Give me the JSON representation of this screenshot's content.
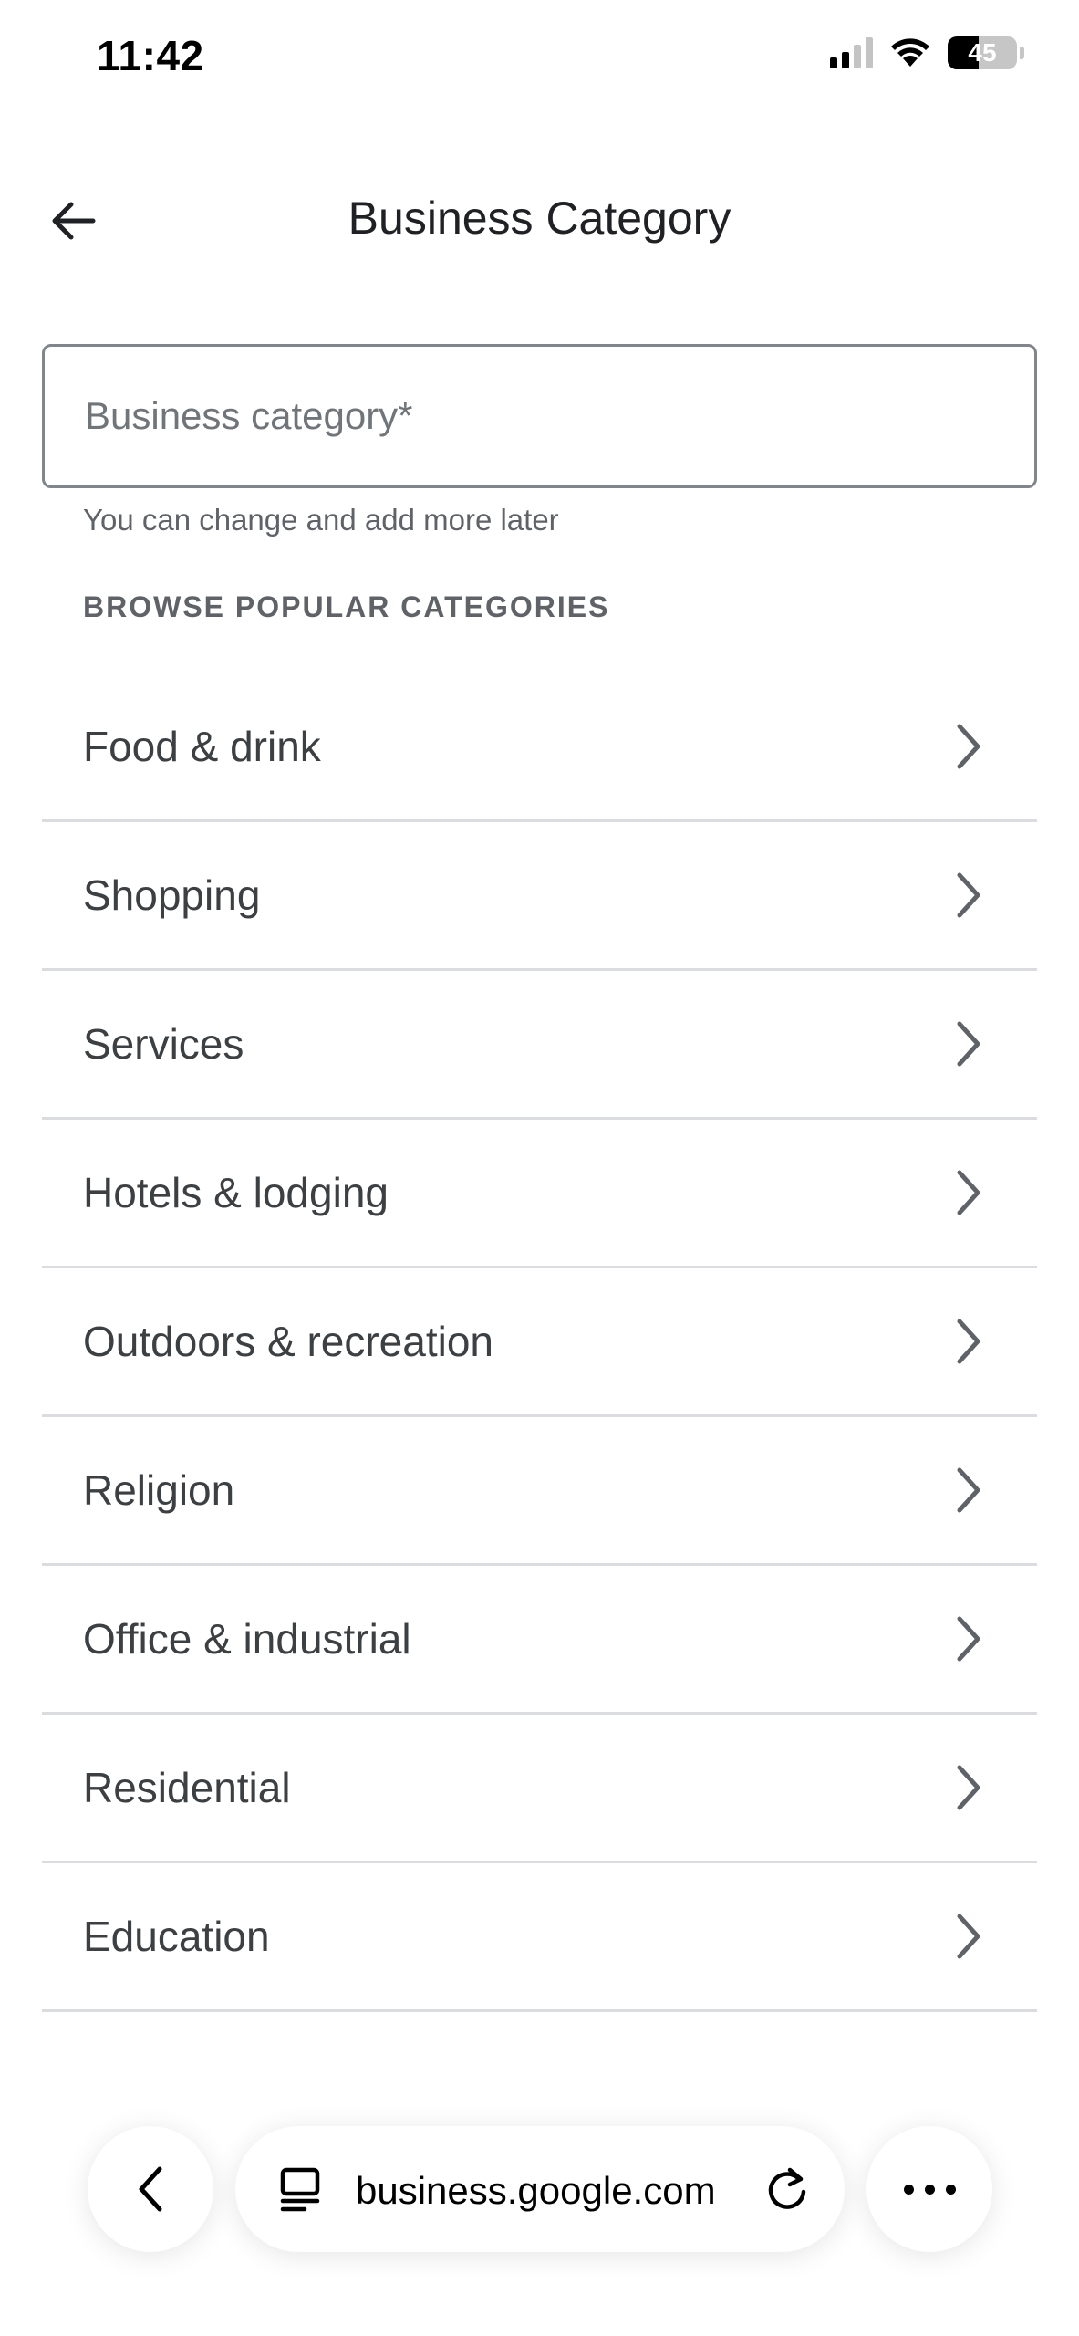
{
  "status_bar": {
    "time": "11:42",
    "battery_percent": "45"
  },
  "header": {
    "title": "Business Category",
    "back_icon": "arrow-left-icon"
  },
  "search": {
    "placeholder": "Business category*",
    "value": "",
    "helper_text": "You can change and add more later"
  },
  "browse": {
    "heading": "BROWSE POPULAR CATEGORIES",
    "items": [
      {
        "label": "Food & drink"
      },
      {
        "label": "Shopping"
      },
      {
        "label": "Services"
      },
      {
        "label": "Hotels & lodging"
      },
      {
        "label": "Outdoors & recreation"
      },
      {
        "label": "Religion"
      },
      {
        "label": "Office & industrial"
      },
      {
        "label": "Residential"
      },
      {
        "label": "Education"
      }
    ]
  },
  "browser": {
    "url": "business.google.com",
    "icons": [
      "chevron-left-icon",
      "reader-icon",
      "reload-icon",
      "more-icon"
    ]
  },
  "colors": {
    "text_primary": "#202124",
    "text_secondary": "#5f6368",
    "divider": "#dadce0",
    "input_border": "#80868b"
  }
}
